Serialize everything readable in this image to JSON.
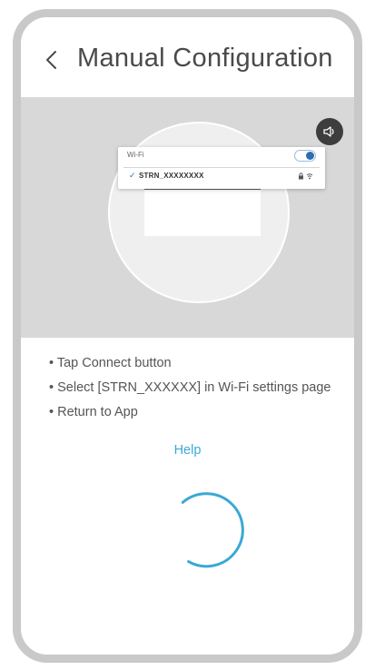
{
  "header": {
    "title": "Manual Configuration",
    "back_icon": "chevron-left-icon"
  },
  "illustration": {
    "sound_icon": "speaker-icon",
    "wifi_label": "Wi-Fi",
    "wifi_toggle_on": true,
    "network_name": "STRN_XXXXXXXX",
    "network_check_icon": "checkmark-icon",
    "network_status_icons": [
      "lock-icon",
      "wifi-signal-icon"
    ]
  },
  "instructions": [
    "Tap Connect button",
    "Select [STRN_XXXXXX] in Wi-Fi settings page",
    "Return to App"
  ],
  "help_link": "Help",
  "colors": {
    "accent": "#3aa8d6",
    "toggle_blue": "#2e6db4",
    "illustration_bg": "#d8d8d8",
    "frame": "#c9c9c9"
  },
  "loading_icon": "loading-spinner-icon"
}
